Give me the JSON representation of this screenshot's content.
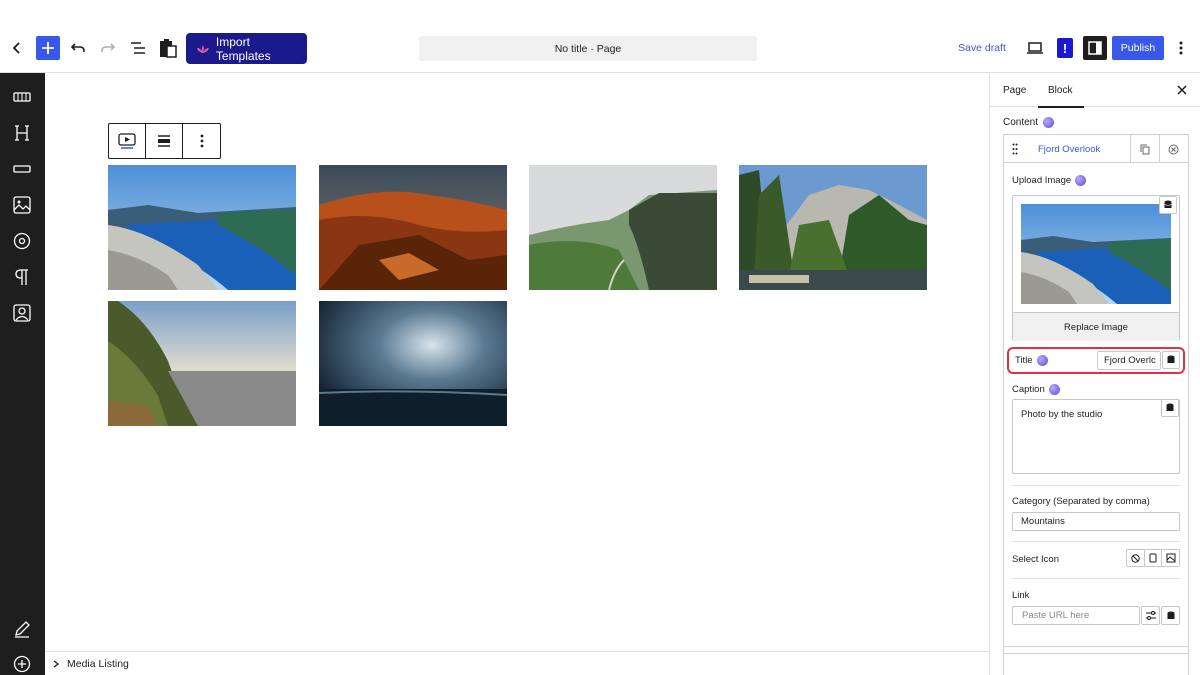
{
  "topbar": {
    "import_label": "Import Templates",
    "doc_title": "No title · Page",
    "save_draft": "Save draft",
    "publish": "Publish",
    "notice": "!"
  },
  "rail": {
    "icons": [
      "slider-icon",
      "heading-icon",
      "divider-icon",
      "image-icon",
      "circle-target-icon",
      "paragraph-icon",
      "contact-icon",
      "edit-icon",
      "add-circle-icon"
    ]
  },
  "footer": {
    "breadcrumb": "Media Listing"
  },
  "inspector": {
    "tabs": [
      "Page",
      "Block"
    ],
    "active_tab": "Block",
    "content_label": "Content",
    "item": {
      "name": "Fjord Overlook",
      "upload_label": "Upload Image",
      "replace_label": "Replace Image",
      "title_label": "Title",
      "title_value": "Fjord Overlc",
      "caption_label": "Caption",
      "caption_value": "Photo by the studio",
      "category_label": "Category (Separated by comma)",
      "category_value": "Mountains",
      "icon_label": "Select Icon",
      "link_label": "Link",
      "link_placeholder": "Paste URL here"
    }
  },
  "gallery": {
    "photos": [
      "fjord",
      "red-rocks",
      "green-cliffs",
      "yosemite",
      "coastal-cliff",
      "stormy-sea"
    ]
  },
  "colors": {
    "accent": "#3858e9",
    "import_bg": "#1a1a8c",
    "highlight": "#e0304a",
    "rail_bg": "#1e1e1e"
  }
}
